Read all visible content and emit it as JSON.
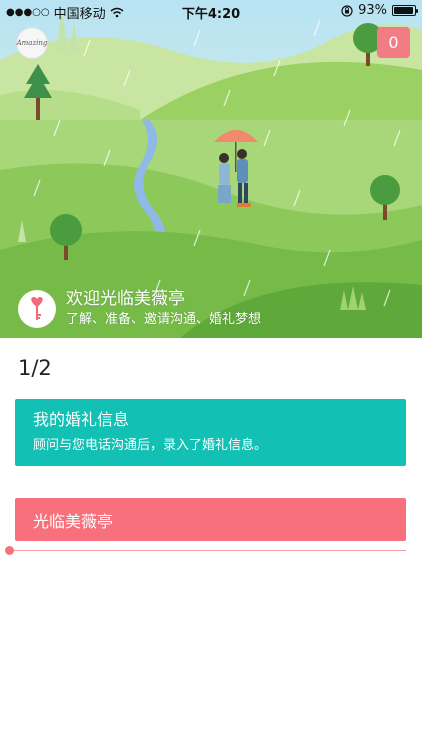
{
  "status_bar": {
    "signal": "●●●○○",
    "carrier": "中国移动",
    "time": "下午4:20",
    "battery_percent": "93%",
    "battery_level": 0.93
  },
  "header": {
    "logo_text": "Amazing",
    "badge_count": "0"
  },
  "banner": {
    "title": "欢迎光临美薇亭",
    "subtitle": "了解、准备、邀请沟通、婚礼梦想"
  },
  "pager": {
    "indicator": "1/2"
  },
  "cards": {
    "wedding_info_title": "我的婚礼信息",
    "wedding_info_desc": "顾问与您电话沟通后，录入了婚礼信息。",
    "welcome_card_title": "光临美薇亭"
  },
  "progress": {
    "value": 0
  },
  "colors": {
    "teal": "#12c0b4",
    "pink": "#f7707c",
    "badge": "#f27c84",
    "grass": "#8cc85a"
  }
}
